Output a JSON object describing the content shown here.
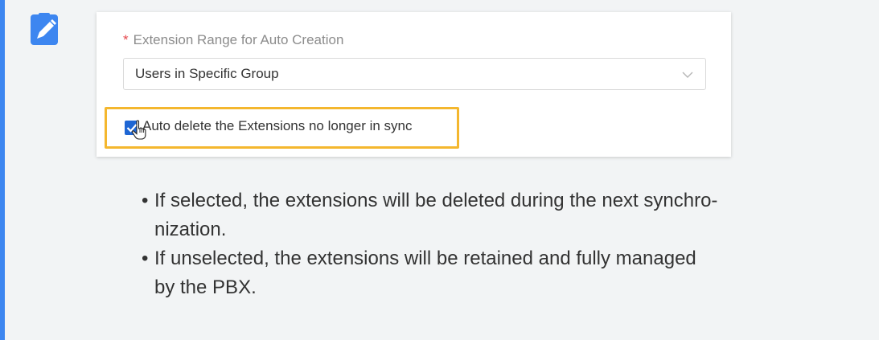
{
  "note": {
    "icon": "edit-note-icon",
    "accent_color": "#3d86f0"
  },
  "form": {
    "required_mark": "*",
    "field_label": "Extension Range for Auto Creation",
    "select_value": "Users in Specific Group",
    "select_arrow_icon": "chevron-down-icon",
    "checkbox_checked": true,
    "checkbox_label": "Auto delete the Extensions no longer in sync",
    "highlight_color": "#f4b72e"
  },
  "bullets": [
    {
      "dot": "•",
      "line1": "If selected, the extensions will be deleted during the next synchro-",
      "line2": "nization."
    },
    {
      "dot": "•",
      "line1": "If unselected, the extensions will be retained and fully managed",
      "line2": "by the PBX."
    }
  ]
}
